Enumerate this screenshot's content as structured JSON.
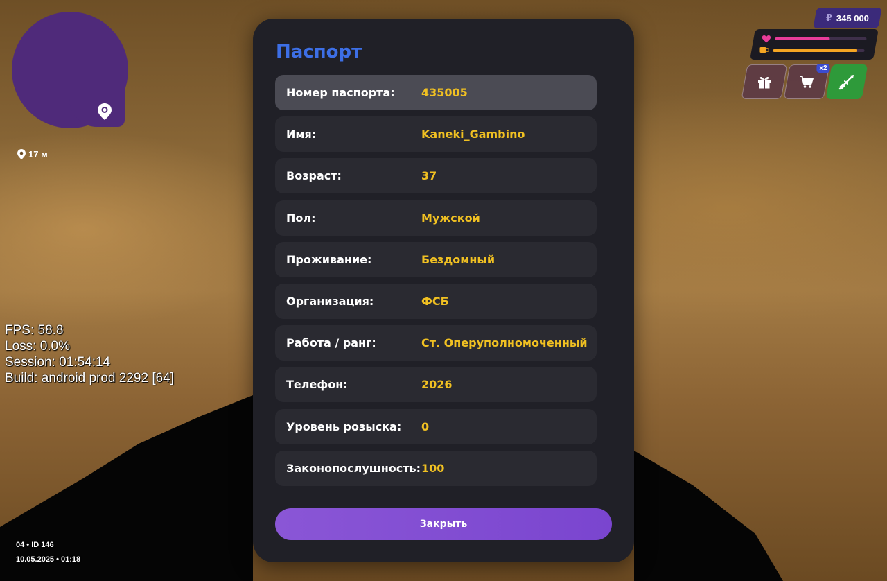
{
  "minimap": {
    "distance": "17 м"
  },
  "debug": {
    "fps": "FPS: 58.8",
    "loss": "Loss: 0.0%",
    "session": "Session: 01:54:14",
    "build": "Build: android prod 2292 [64]"
  },
  "meta": {
    "server": "04 • ID 146",
    "datetime": "10.05.2025 • 01:18"
  },
  "hud": {
    "currency_symbol": "₽",
    "money": "345 000",
    "health_fraction": 0.6,
    "hunger_fraction": 0.92,
    "health_color": "#e83c9a",
    "hunger_color": "#f5a623",
    "cart_badge": "x2",
    "icons": [
      "gift-icon",
      "cart-icon",
      "weapon-icon",
      "heart-icon",
      "food-icon"
    ]
  },
  "passport": {
    "title": "Паспорт",
    "rows": [
      {
        "label": "Номер паспорта:",
        "value": "435005"
      },
      {
        "label": "Имя:",
        "value": "Kaneki_Gambino"
      },
      {
        "label": "Возраст:",
        "value": "37"
      },
      {
        "label": "Пол:",
        "value": "Мужской"
      },
      {
        "label": "Проживание:",
        "value": "Бездомный"
      },
      {
        "label": "Организация:",
        "value": "ФСБ"
      },
      {
        "label": "Работа / ранг:",
        "value": "Ст. Оперуполномоченный"
      },
      {
        "label": "Телефон:",
        "value": "2026"
      },
      {
        "label": "Уровень розыска:",
        "value": "0"
      },
      {
        "label": "Законопослушность:",
        "value": "100"
      }
    ],
    "close_label": "Закрыть"
  },
  "colors": {
    "title": "#3d6fe6",
    "value": "#f0c022",
    "panel": "#202027",
    "button": "#8a56d6",
    "minimap": "#4f2a7a"
  }
}
